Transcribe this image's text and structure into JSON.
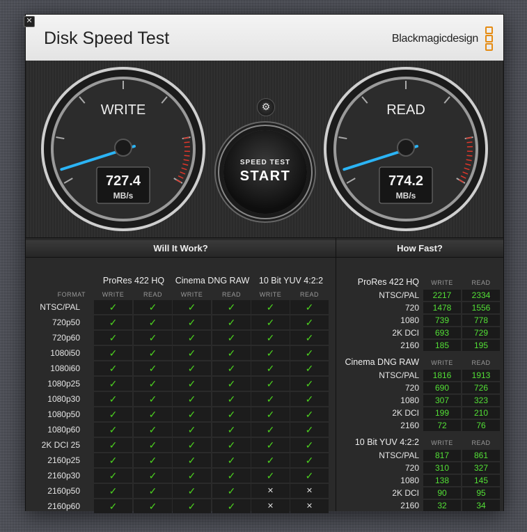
{
  "app": {
    "title": "Disk Speed Test",
    "brand": "Blackmagicdesign",
    "close_glyph": "✕"
  },
  "gauges": {
    "write": {
      "label": "WRITE",
      "value": "727.4",
      "unit": "MB/s"
    },
    "read": {
      "label": "READ",
      "value": "774.2",
      "unit": "MB/s"
    }
  },
  "controls": {
    "settings_icon": "⚙",
    "start_small": "SPEED TEST",
    "start_big": "START"
  },
  "will_it_work": {
    "title": "Will It Work?",
    "format_label": "FORMAT",
    "groups": [
      "ProRes 422 HQ",
      "Cinema DNG RAW",
      "10 Bit YUV 4:2:2"
    ],
    "sub_labels": [
      "WRITE",
      "READ"
    ],
    "rows": [
      {
        "format": "NTSC/PAL",
        "cells": [
          1,
          1,
          1,
          1,
          1,
          1
        ]
      },
      {
        "format": "720p50",
        "cells": [
          1,
          1,
          1,
          1,
          1,
          1
        ]
      },
      {
        "format": "720p60",
        "cells": [
          1,
          1,
          1,
          1,
          1,
          1
        ]
      },
      {
        "format": "1080i50",
        "cells": [
          1,
          1,
          1,
          1,
          1,
          1
        ]
      },
      {
        "format": "1080i60",
        "cells": [
          1,
          1,
          1,
          1,
          1,
          1
        ]
      },
      {
        "format": "1080p25",
        "cells": [
          1,
          1,
          1,
          1,
          1,
          1
        ]
      },
      {
        "format": "1080p30",
        "cells": [
          1,
          1,
          1,
          1,
          1,
          1
        ]
      },
      {
        "format": "1080p50",
        "cells": [
          1,
          1,
          1,
          1,
          1,
          1
        ]
      },
      {
        "format": "1080p60",
        "cells": [
          1,
          1,
          1,
          1,
          1,
          1
        ]
      },
      {
        "format": "2K DCI 25",
        "cells": [
          1,
          1,
          1,
          1,
          1,
          1
        ]
      },
      {
        "format": "2160p25",
        "cells": [
          1,
          1,
          1,
          1,
          1,
          1
        ]
      },
      {
        "format": "2160p30",
        "cells": [
          1,
          1,
          1,
          1,
          1,
          1
        ]
      },
      {
        "format": "2160p50",
        "cells": [
          1,
          1,
          1,
          1,
          0,
          0
        ]
      },
      {
        "format": "2160p60",
        "cells": [
          1,
          1,
          1,
          1,
          0,
          0
        ]
      }
    ],
    "ok_glyph": "✓",
    "no_glyph": "✕"
  },
  "how_fast": {
    "title": "How Fast?",
    "groups": [
      {
        "name": "ProRes 422 HQ",
        "rows": [
          {
            "format": "NTSC/PAL",
            "write": "2217",
            "read": "2334"
          },
          {
            "format": "720",
            "write": "1478",
            "read": "1556"
          },
          {
            "format": "1080",
            "write": "739",
            "read": "778"
          },
          {
            "format": "2K DCI",
            "write": "693",
            "read": "729"
          },
          {
            "format": "2160",
            "write": "185",
            "read": "195"
          }
        ]
      },
      {
        "name": "Cinema DNG RAW",
        "rows": [
          {
            "format": "NTSC/PAL",
            "write": "1816",
            "read": "1913"
          },
          {
            "format": "720",
            "write": "690",
            "read": "726"
          },
          {
            "format": "1080",
            "write": "307",
            "read": "323"
          },
          {
            "format": "2K DCI",
            "write": "199",
            "read": "210"
          },
          {
            "format": "2160",
            "write": "72",
            "read": "76"
          }
        ]
      },
      {
        "name": "10 Bit YUV 4:2:2",
        "rows": [
          {
            "format": "NTSC/PAL",
            "write": "817",
            "read": "861"
          },
          {
            "format": "720",
            "write": "310",
            "read": "327"
          },
          {
            "format": "1080",
            "write": "138",
            "read": "145"
          },
          {
            "format": "2K DCI",
            "write": "90",
            "read": "95"
          },
          {
            "format": "2160",
            "write": "32",
            "read": "34"
          }
        ]
      }
    ]
  },
  "colors": {
    "accent_needle": "#2bb4f5",
    "ok_green": "#4cd11f",
    "number_green": "#53e036",
    "logo_orange": "#e58b12",
    "redline": "#e0362a"
  }
}
